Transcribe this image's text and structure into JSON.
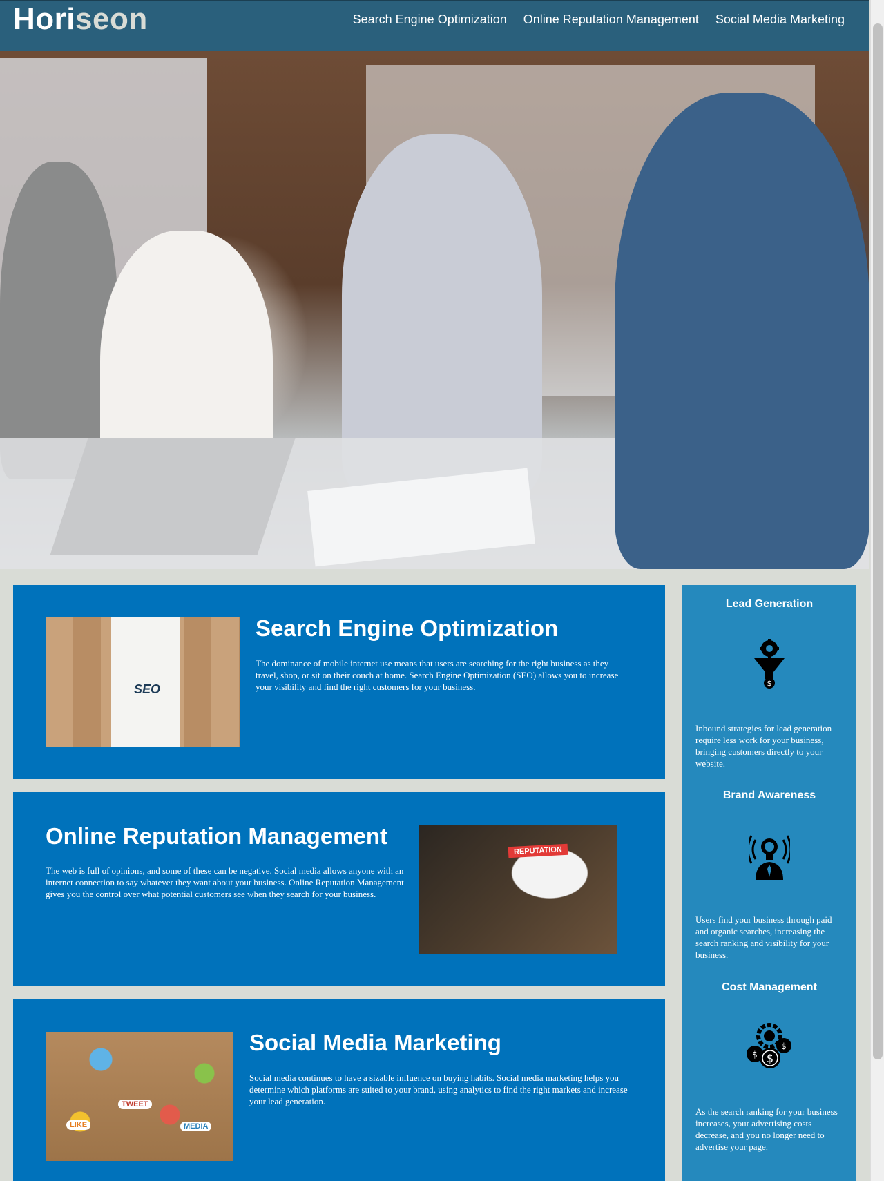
{
  "header": {
    "logo_main": "Hori",
    "logo_accent": "seon",
    "nav": [
      {
        "label": "Search Engine Optimization"
      },
      {
        "label": "Online Reputation Management"
      },
      {
        "label": "Social Media Marketing"
      }
    ]
  },
  "hero": {
    "image_icon": "team-meeting-photo"
  },
  "content": {
    "seo": {
      "title": "Search Engine Optimization",
      "text": "The dominance of mobile internet use means that users are searching for the right business as they travel, shop, or sit on their couch at home. Search Engine Optimization (SEO) allows you to increase your visibility and find the right customers for your business.",
      "image_word": "SEO"
    },
    "orm": {
      "title": "Online Reputation Management",
      "text": "The web is full of opinions, and some of these can be negative. Social media allows anyone with an internet connection to say whatever they want about your business. Online Reputation Management gives you the control over what potential customers see when they search for your business.",
      "image_word": "REPUTATION"
    },
    "smm": {
      "title": "Social Media Marketing",
      "text": "Social media continues to have a sizable influence on buying habits. Social media marketing helps you determine which platforms are suited to your brand, using analytics to find the right markets and increase your lead generation.",
      "image_words": [
        "TWEET",
        "LIKE",
        "MEDIA"
      ]
    }
  },
  "benefits": [
    {
      "title": "Lead Generation",
      "icon": "lead-funnel-icon",
      "text": "Inbound strategies for lead generation require less work for your business, bringing customers directly to your website."
    },
    {
      "title": "Brand Awareness",
      "icon": "brand-lightbulb-icon",
      "text": "Users find your business through paid and organic searches, increasing the search ranking and visibility for your business."
    },
    {
      "title": "Cost Management",
      "icon": "cost-coins-icon",
      "text": "As the search ranking for your business increases, your advertising costs decrease, and you no longer need to advertise your page."
    }
  ]
}
